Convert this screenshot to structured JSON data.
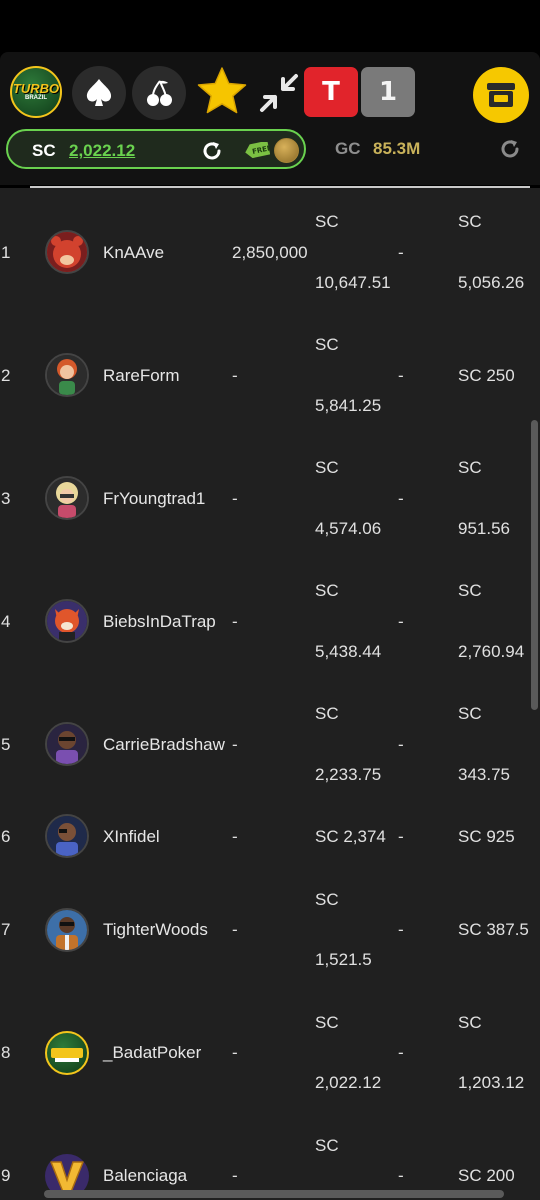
{
  "header": {
    "logo_text": "TURBO",
    "logo_subtext": "BRAZIL",
    "icons": [
      "spade-icon",
      "cherries-icon",
      "star-icon",
      "collapse-icon",
      "store-icon"
    ],
    "tab_t_label": "T",
    "tab_one_label": "1",
    "colors": {
      "accent_green": "#6ad24f",
      "gold": "#c9b25a",
      "red": "#e1242b",
      "yellow": "#f6c800"
    }
  },
  "balance": {
    "sc_label": "SC",
    "sc_value": "2,022.12",
    "free_tag": "FREE",
    "gc_label": "GC",
    "gc_value": "85.3M"
  },
  "leaderboard": [
    {
      "rank": "1",
      "name": "KnAAve",
      "col1": "2,850,000",
      "col2_top": "SC",
      "col2_bottom": "10,647.51",
      "col2_dash": "-",
      "col3_top": "SC",
      "col3_bottom": "5,056.26"
    },
    {
      "rank": "2",
      "name": "RareForm",
      "col1": "-",
      "col2_top": "SC",
      "col2_bottom": "5,841.25",
      "col2_dash": "-",
      "col3_top": "",
      "col3_bottom": "SC 250"
    },
    {
      "rank": "3",
      "name": "FrYoungtrad1",
      "col1": "-",
      "col2_top": "SC",
      "col2_bottom": "4,574.06",
      "col2_dash": "-",
      "col3_top": "SC",
      "col3_bottom": "951.56"
    },
    {
      "rank": "4",
      "name": "BiebsInDaTrap",
      "col1": "-",
      "col2_top": "SC",
      "col2_bottom": "5,438.44",
      "col2_dash": "-",
      "col3_top": "SC",
      "col3_bottom": "2,760.94"
    },
    {
      "rank": "5",
      "name": "CarrieBradshaw",
      "col1": "-",
      "col2_top": "SC",
      "col2_bottom": "2,233.75",
      "col2_dash": "-",
      "col3_top": "SC",
      "col3_bottom": "343.75"
    },
    {
      "rank": "6",
      "name": "XInfidel",
      "col1": "-",
      "col2_top": "SC 2,374",
      "col2_bottom": "",
      "col2_dash": "-",
      "col3_top": "SC 925",
      "col3_bottom": ""
    },
    {
      "rank": "7",
      "name": "TighterWoods",
      "col1": "-",
      "col2_top": "SC",
      "col2_bottom": "1,521.5",
      "col2_dash": "-",
      "col3_top": "",
      "col3_bottom": "SC 387.5"
    },
    {
      "rank": "8",
      "name": "_BadatPoker",
      "col1": "-",
      "col2_top": "SC",
      "col2_bottom": "2,022.12",
      "col2_dash": "-",
      "col3_top": "SC",
      "col3_bottom": "1,203.12"
    },
    {
      "rank": "9",
      "name": "Balenciaga",
      "col1": "-",
      "col2_top": "SC",
      "col2_bottom": "",
      "col2_dash": "-",
      "col3_top": "",
      "col3_bottom": "SC 200"
    }
  ]
}
